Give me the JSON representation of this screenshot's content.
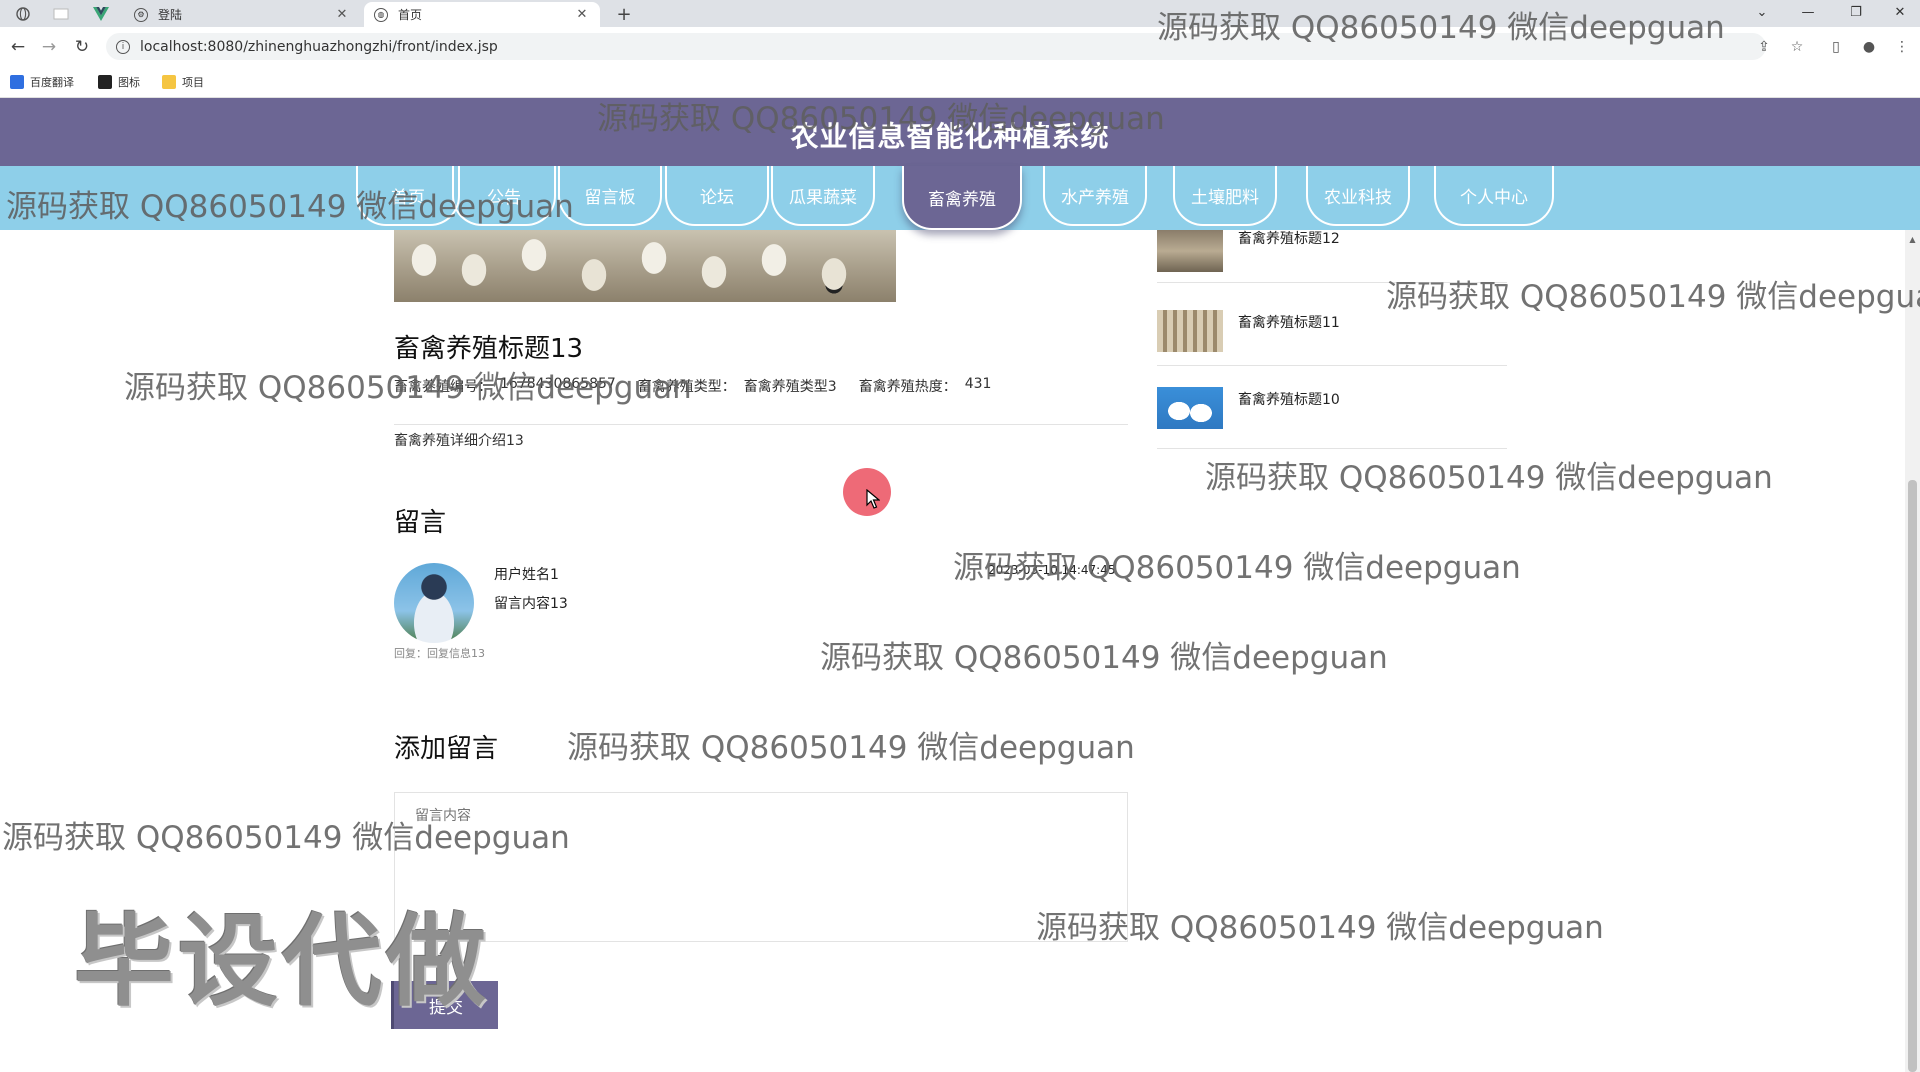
{
  "browser": {
    "tabs": [
      {
        "title": "登陆"
      },
      {
        "title": "首页"
      }
    ],
    "tab_close": "✕",
    "new_tab": "+",
    "url": "localhost:8080/zhinenghuazhongzhi/front/index.jsp",
    "bookmarks": [
      "百度翻译",
      "图标",
      "项目"
    ]
  },
  "site": {
    "title": "农业信息智能化种植系统",
    "nav": [
      "首页",
      "公告",
      "留言板",
      "论坛",
      "瓜果蔬菜",
      "畜禽养殖",
      "水产养殖",
      "土壤肥料",
      "农业科技",
      "个人中心"
    ],
    "active_nav": "畜禽养殖"
  },
  "detail": {
    "title": "畜禽养殖标题13",
    "meta": [
      {
        "label": "畜禽养殖编号：",
        "value": "1678430865857"
      },
      {
        "label": "畜禽养殖类型：",
        "value": "畜禽养殖类型3"
      },
      {
        "label": "畜禽养殖热度：",
        "value": "431"
      }
    ],
    "intro": "畜禽养殖详细介绍13"
  },
  "comments": {
    "section_title": "留言",
    "items": [
      {
        "user": "用户姓名1",
        "content": "留言内容13",
        "time": "2023-03-10 14:47:45",
        "reply": "回复：回复信息13"
      }
    ]
  },
  "add_comment": {
    "section_title": "添加留言",
    "placeholder": "留言内容",
    "submit_label": "提交"
  },
  "sidebar": {
    "items": [
      {
        "title": "畜禽养殖标题12"
      },
      {
        "title": "畜禽养殖标题11"
      },
      {
        "title": "畜禽养殖标题10"
      }
    ]
  },
  "watermarks": {
    "repeat_text": "源码获取 QQ86050149 微信deepguan",
    "big_text": "毕设代做"
  },
  "colors": {
    "header_purple": "#6c6694",
    "nav_blue": "#8ecfe9",
    "cursor_red": "#eb505f"
  }
}
